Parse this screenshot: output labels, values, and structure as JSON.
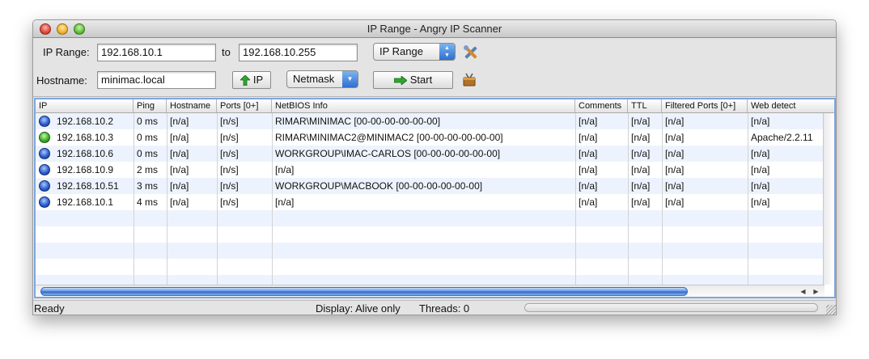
{
  "window": {
    "title": "IP Range - Angry IP Scanner"
  },
  "toolbar": {
    "ip_range_label": "IP Range:",
    "ip_from": "192.168.10.1",
    "to_label": "to",
    "ip_to": "192.168.10.255",
    "feeder_select": "IP Range",
    "hostname_label": "Hostname:",
    "hostname_value": "minimac.local",
    "ip_button_label": "IP",
    "netmask_select": "Netmask",
    "start_button_label": "Start"
  },
  "table": {
    "columns": [
      "IP",
      "Ping",
      "Hostname",
      "Ports [0+]",
      "NetBIOS Info",
      "Comments",
      "TTL",
      "Filtered Ports [0+]",
      "Web detect"
    ],
    "rows": [
      {
        "status": "blue",
        "ip": "192.168.10.2",
        "ping": "0 ms",
        "hostname": "[n/a]",
        "ports": "[n/s]",
        "netbios": "RIMAR\\MINIMAC [00-00-00-00-00-00]",
        "comments": "[n/a]",
        "ttl": "[n/a]",
        "filtered": "[n/a]",
        "web": "[n/a]"
      },
      {
        "status": "green",
        "ip": "192.168.10.3",
        "ping": "0 ms",
        "hostname": "[n/a]",
        "ports": "[n/s]",
        "netbios": "RIMAR\\MINIMAC2@MINIMAC2 [00-00-00-00-00-00]",
        "comments": "[n/a]",
        "ttl": "[n/a]",
        "filtered": "[n/a]",
        "web": "Apache/2.2.11"
      },
      {
        "status": "blue",
        "ip": "192.168.10.6",
        "ping": "0 ms",
        "hostname": "[n/a]",
        "ports": "[n/s]",
        "netbios": "WORKGROUP\\IMAC-CARLOS [00-00-00-00-00-00]",
        "comments": "[n/a]",
        "ttl": "[n/a]",
        "filtered": "[n/a]",
        "web": "[n/a]"
      },
      {
        "status": "blue",
        "ip": "192.168.10.9",
        "ping": "2 ms",
        "hostname": "[n/a]",
        "ports": "[n/s]",
        "netbios": "[n/a]",
        "comments": "[n/a]",
        "ttl": "[n/a]",
        "filtered": "[n/a]",
        "web": "[n/a]"
      },
      {
        "status": "blue",
        "ip": "192.168.10.51",
        "ping": "3 ms",
        "hostname": "[n/a]",
        "ports": "[n/s]",
        "netbios": "WORKGROUP\\MACBOOK [00-00-00-00-00-00]",
        "comments": "[n/a]",
        "ttl": "[n/a]",
        "filtered": "[n/a]",
        "web": "[n/a]"
      },
      {
        "status": "blue",
        "ip": "192.168.10.1",
        "ping": "4 ms",
        "hostname": "[n/a]",
        "ports": "[n/s]",
        "netbios": "[n/a]",
        "comments": "[n/a]",
        "ttl": "[n/a]",
        "filtered": "[n/a]",
        "web": "[n/a]"
      }
    ]
  },
  "status": {
    "left": "Ready",
    "display": "Display: Alive only",
    "threads": "Threads: 0",
    "progress": 0
  },
  "colors": {
    "alive_blue": "#2b5fd1",
    "alive_green": "#3fb02a",
    "row_alt": "#edf3fe"
  },
  "icons": [
    "close-traffic-light",
    "minimize-traffic-light",
    "zoom-traffic-light",
    "preferences-tools-icon",
    "green-up-arrow-icon",
    "green-right-arrow-icon",
    "fetchers-icon"
  ]
}
